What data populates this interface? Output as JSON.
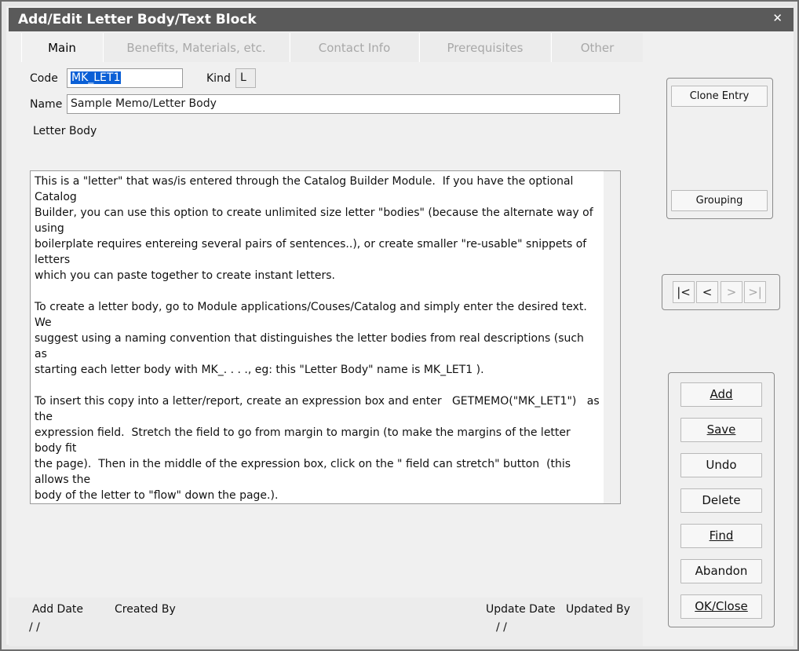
{
  "window": {
    "title": "Add/Edit Letter Body/Text Block",
    "close_glyph": "✕"
  },
  "tabs": [
    {
      "label": "Main",
      "active": true
    },
    {
      "label": "Benefits, Materials, etc.",
      "active": false
    },
    {
      "label": "Contact Info",
      "active": false
    },
    {
      "label": "Prerequisites",
      "active": false
    },
    {
      "label": "Other",
      "active": false
    }
  ],
  "form": {
    "code_label": "Code",
    "code_value": "MK_LET1",
    "kind_label": "Kind",
    "kind_value": "L",
    "name_label": "Name",
    "name_value": "Sample Memo/Letter Body",
    "body_label": "Letter Body",
    "body_text": "This is a \"letter\" that was/is entered through the Catalog Builder Module.  If you have the optional Catalog\nBuilder, you can use this option to create unlimited size letter \"bodies\" (because the alternate way of using\nboilerplate requires entereing several pairs of sentences..), or create smaller \"re-usable\" snippets of letters\nwhich you can paste together to create instant letters.\n\nTo create a letter body, go to Module applications/Couses/Catalog and simply enter the desired text.  We\nsuggest using a naming convention that distinguishes the letter bodies from real descriptions (such as\nstarting each letter body with MK_. . . ., eg: this \"Letter Body\" name is MK_LET1 ).\n\nTo insert this copy into a letter/report, create an expression box and enter   GETMEMO(\"MK_LET1\")   as the\nexpression field.  Stretch the field to go from margin to margin (to make the margins of the letter body fit\nthe page).  Then in the middle of the expression box, click on the \" field can stretch\" button  (this allows the\nbody of the letter to \"flow\" down the page.).\n\nThe advantage of this style of creating boilerplate letters is that it is easier to change the margins and\ncontent.  The disadvantage is that it does NOT allow you to add merge fields within the letter body itself,\nand that you cannot vary the font type and style within the body (the whole body is one style/font).\n\nHope you enjoy this new routine.  Call if you need help.\n\nSincerely,"
  },
  "footer": {
    "add_date_label": "Add Date",
    "add_date_value": "/  /",
    "created_by_label": "Created By",
    "update_date_label": "Update Date",
    "update_date_value": "/  /",
    "updated_by_label": "Updated By"
  },
  "side": {
    "clone_label": "Clone Entry",
    "grouping_label": "Grouping"
  },
  "nav": {
    "first": "|<",
    "prev": "<",
    "next": ">",
    "last": ">|"
  },
  "actions": {
    "add": "Add",
    "save": "Save",
    "undo": "Undo",
    "delete": "Delete",
    "find": "Find",
    "abandon": "Abandon",
    "ok_close": "OK/Close"
  },
  "colors": {
    "titlebar": "#5a5a5a",
    "selection": "#0a5fd6",
    "background": "#f0f0f0"
  }
}
